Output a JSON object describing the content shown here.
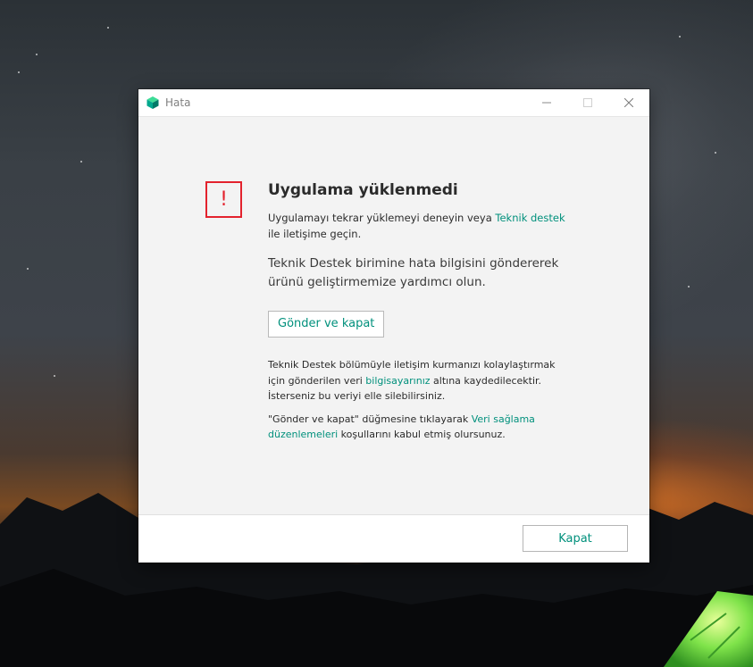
{
  "window": {
    "title": "Hata",
    "icon": "kaspersky-cube-icon",
    "controls": {
      "minimize": "—",
      "maximize": "☐",
      "close": "✕"
    }
  },
  "error": {
    "icon_glyph": "!",
    "heading": "Uygulama yüklenmedi",
    "retry": {
      "before": "Uygulamayı tekrar yüklemeyi deneyin veya ",
      "link": "Teknik destek",
      "after": " ile iletişime geçin."
    },
    "help_text": "Teknik Destek birimine hata bilgisini göndererek ürünü geliştirmemize yardımcı olun.",
    "send_button": "Gönder ve kapat",
    "data_notice": {
      "before": "Teknik Destek bölümüyle iletişim kurmanızı kolaylaştırmak için gönderilen veri ",
      "link": "bilgisayarınız",
      "after": " altına kaydedilecektir. İsterseniz bu veriyi elle silebilirsiniz."
    },
    "consent": {
      "before": "\"Gönder ve kapat\" düğmesine tıklayarak ",
      "link": "Veri sağlama düzenlemeleri",
      "after": " koşullarını kabul etmiş olursunuz."
    }
  },
  "footer": {
    "close_button": "Kapat"
  },
  "colors": {
    "accent": "#00907c",
    "alert": "#e3222d"
  }
}
